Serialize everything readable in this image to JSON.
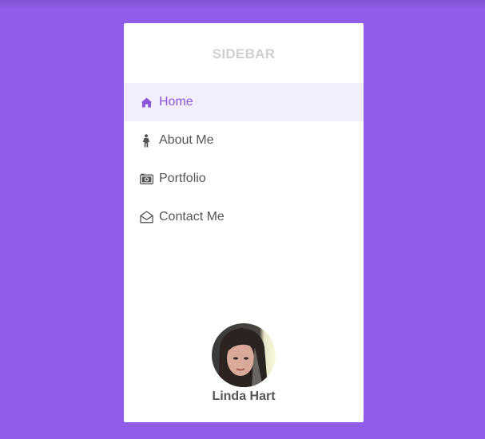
{
  "sidebar": {
    "title": "SIDEBAR",
    "items": [
      {
        "label": "Home",
        "icon": "home-icon",
        "active": true
      },
      {
        "label": "About Me",
        "icon": "person-icon",
        "active": false
      },
      {
        "label": "Portfolio",
        "icon": "camera-icon",
        "active": false
      },
      {
        "label": "Contact Me",
        "icon": "envelope-open-icon",
        "active": false
      }
    ],
    "profile": {
      "name": "Linda Hart"
    }
  },
  "colors": {
    "background": "#8f5de8",
    "accent": "#8a55d8",
    "active_bg": "#f3eefc",
    "text": "#555555",
    "title": "#cfcfcf"
  }
}
